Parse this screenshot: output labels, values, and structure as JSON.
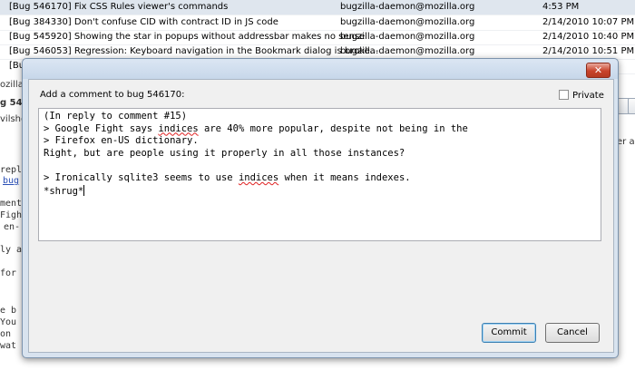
{
  "messages": [
    {
      "subject": "[Bug 546170] Fix CSS Rules viewer's commands",
      "from": "bugzilla-daemon@mozilla.org",
      "date": "4:53 PM"
    },
    {
      "subject": "[Bug 384330] Don't confuse CID with contract ID in JS code",
      "from": "bugzilla-daemon@mozilla.org",
      "date": "2/14/2010 10:07 PM"
    },
    {
      "subject": "[Bug 545920] Showing the star in popups without addressbar makes no sense",
      "from": "bugzilla-daemon@mozilla.org",
      "date": "2/14/2010 10:40 PM"
    },
    {
      "subject": "[Bug 546053] Regression: Keyboard navigation in the Bookmark dialog is broke...",
      "from": "bugzilla-daemon@mozilla.org",
      "date": "2/14/2010 10:51 PM"
    },
    {
      "subject": "[Bu",
      "from": "",
      "date": ""
    }
  ],
  "background_left": {
    "row_a": "ozilla-",
    "row_b": "g 546",
    "row_c": "vilsh@",
    "row_d": "repl",
    "row_e": "bug",
    "row_f": "ment",
    "row_g": "Figh",
    "row_h": "en-",
    "row_i": "ly a",
    "row_j": "for",
    "row_k": "e b",
    "row_l": "You",
    "row_m": "on",
    "row_n": "wat"
  },
  "background_right": {
    "text": "er ad"
  },
  "dialog": {
    "close_symbol": "✕",
    "label": "Add a comment to bug 546170:",
    "private_label": "Private",
    "private_checked": false,
    "comment_lines": [
      "(In reply to comment #15)",
      "> Google Fight says ",
      "indices",
      " are 40% more popular, despite not being in the",
      "> Firefox en-US dictionary.",
      "Right, but are people using it properly in all those instances?",
      "",
      "> Ironically sqlite3 seems to use ",
      "indices",
      " when it means indexes.",
      "*shrug*"
    ],
    "commit_label": "Commit",
    "cancel_label": "Cancel"
  }
}
